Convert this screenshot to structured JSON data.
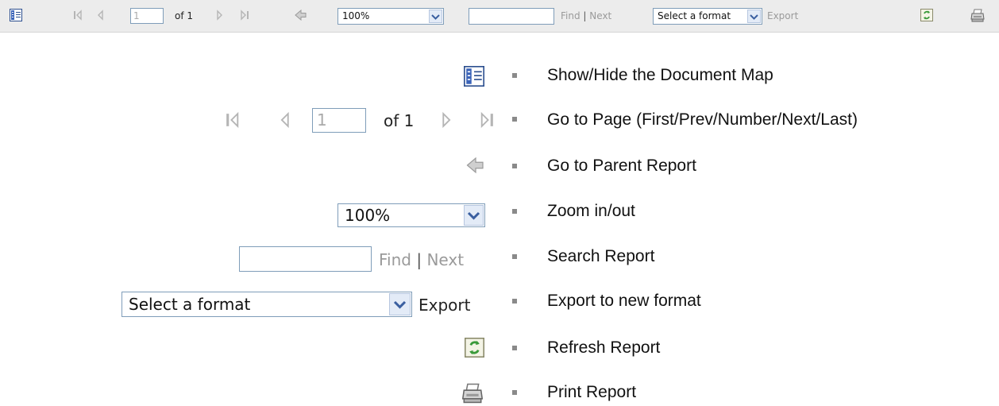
{
  "toolbar": {
    "page_number": "1",
    "page_of": "of 1",
    "zoom_value": "100%",
    "find_label": "Find",
    "separator": "|",
    "next_label": "Next",
    "format_value": "Select a format",
    "export_label": "Export"
  },
  "legend": {
    "items": [
      {
        "label": "Show/Hide the Document Map"
      },
      {
        "label": "Go to Page (First/Prev/Number/Next/Last)"
      },
      {
        "label": "Go to Parent Report"
      },
      {
        "label": "Zoom in/out"
      },
      {
        "label": "Search Report"
      },
      {
        "label": "Export to new format"
      },
      {
        "label": "Refresh Report"
      },
      {
        "label": "Print Report"
      }
    ],
    "page_number": "1",
    "page_of": "of 1",
    "zoom_value": "100%",
    "find_label": "Find",
    "separator": "|",
    "next_label": "Next",
    "format_value": "Select a format",
    "export_label": "Export"
  },
  "icons": [
    "document-map-icon",
    "first-page-icon",
    "previous-page-icon",
    "next-page-icon",
    "last-page-icon",
    "parent-report-icon",
    "refresh-icon",
    "print-icon"
  ],
  "colors": {
    "toolbar_bg": "#ececec",
    "input_border": "#7f9db9",
    "disabled_text": "#9a9a9a",
    "refresh_green": "#3a9a3a"
  }
}
